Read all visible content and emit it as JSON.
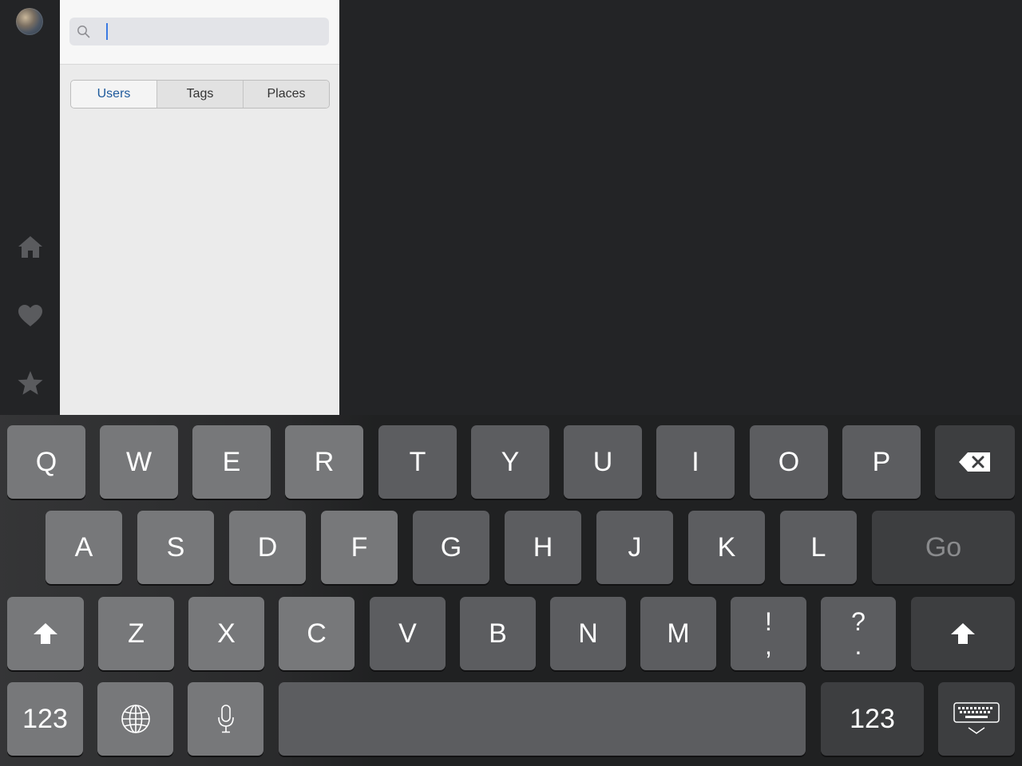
{
  "rail": {
    "icons": [
      "avatar",
      "home-icon",
      "heart-icon",
      "star-icon"
    ]
  },
  "search": {
    "placeholder": "",
    "value": ""
  },
  "segments": {
    "users": "Users",
    "tags": "Tags",
    "places": "Places"
  },
  "colors": {
    "background": "#232426",
    "panel": "#ebebeb",
    "selected_segment_text": "#1e5a9c",
    "caret": "#3b7ae2"
  },
  "keyboard": {
    "row1": [
      "Q",
      "W",
      "E",
      "R",
      "T",
      "Y",
      "U",
      "I",
      "O",
      "P"
    ],
    "row2": [
      "A",
      "S",
      "D",
      "F",
      "G",
      "H",
      "J",
      "K",
      "L"
    ],
    "row3": [
      "Z",
      "X",
      "C",
      "V",
      "B",
      "N",
      "M"
    ],
    "punct1_top": "!",
    "punct1_bottom": ",",
    "punct2_top": "?",
    "punct2_bottom": ".",
    "go": "Go",
    "numbers_left": "123",
    "numbers_right": "123",
    "icons": [
      "backspace-icon",
      "shift-icon",
      "globe-icon",
      "microphone-icon",
      "keyboard-dismiss-icon"
    ]
  }
}
